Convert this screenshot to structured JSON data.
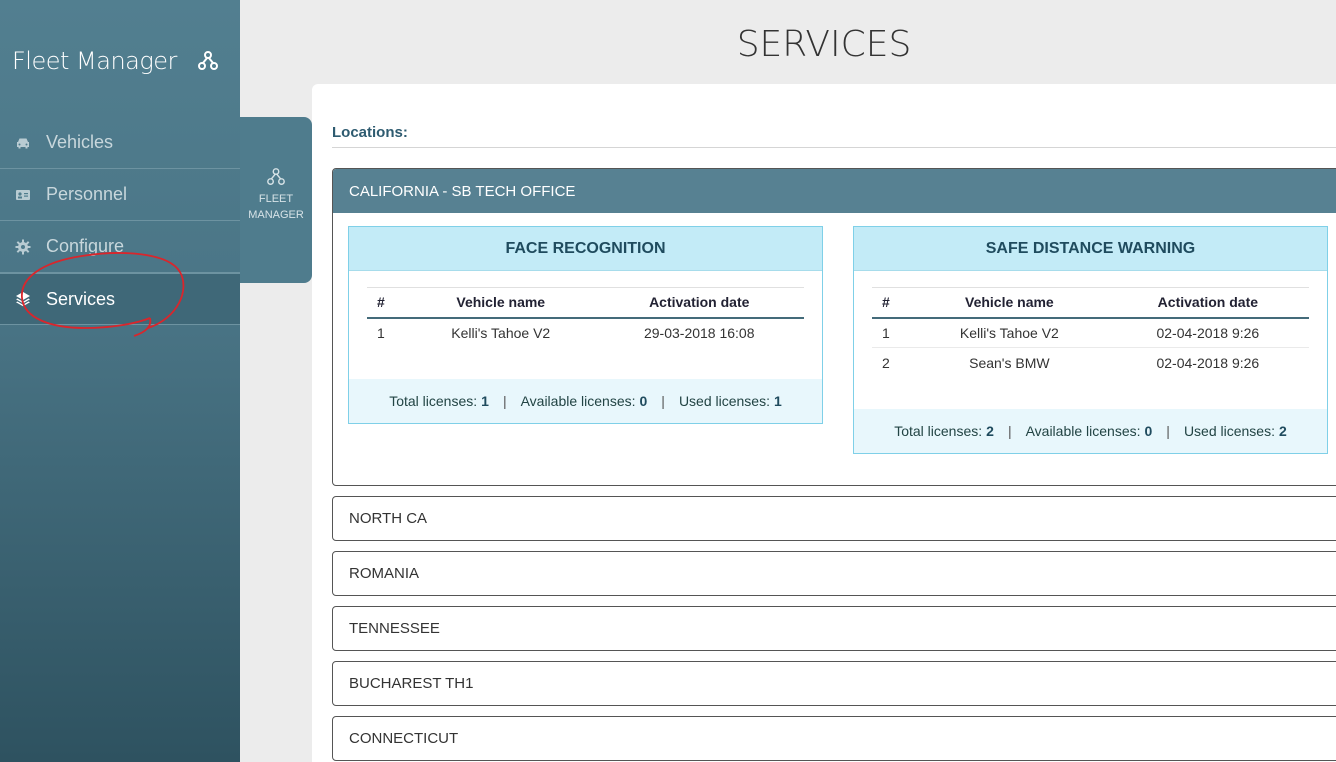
{
  "sidebar": {
    "brand": "Fleet Manager",
    "brand_icon": "nodes-icon",
    "items": [
      {
        "label": "Vehicles",
        "icon": "car-icon"
      },
      {
        "label": "Personnel",
        "icon": "id-card-icon"
      },
      {
        "label": "Configure",
        "icon": "gear-icon"
      },
      {
        "label": "Services",
        "icon": "layers-icon",
        "active": true
      }
    ]
  },
  "subtab": {
    "label": "FLEET\nMANAGER",
    "icon": "nodes-icon"
  },
  "header": {
    "title": "SERVICES"
  },
  "main": {
    "locations_label": "Locations:",
    "open_location": {
      "name": "CALIFORNIA - SB TECH OFFICE",
      "services": [
        {
          "title": "FACE RECOGNITION",
          "columns": [
            "#",
            "Vehicle name",
            "Activation date"
          ],
          "rows": [
            [
              "1",
              "Kelli's Tahoe V2",
              "29-03-2018 16:08"
            ]
          ],
          "total_label": "Total licenses:",
          "total": "1",
          "available_label": "Available licenses:",
          "available": "0",
          "used_label": "Used licenses:",
          "used": "1"
        },
        {
          "title": "SAFE DISTANCE WARNING",
          "columns": [
            "#",
            "Vehicle name",
            "Activation date"
          ],
          "rows": [
            [
              "1",
              "Kelli's Tahoe V2",
              "02-04-2018 9:26"
            ],
            [
              "2",
              "Sean's BMW",
              "02-04-2018 9:26"
            ]
          ],
          "total_label": "Total licenses:",
          "total": "2",
          "available_label": "Available licenses:",
          "available": "0",
          "used_label": "Used licenses:",
          "used": "2"
        }
      ]
    },
    "other_locations": [
      "NORTH CA",
      "ROMANIA",
      "TENNESSEE",
      "BUCHAREST TH1",
      "CONNECTICUT"
    ],
    "separator": "|"
  },
  "colors": {
    "sidebar": "#4a7586",
    "accent": "#578192",
    "service_header": "#c3ebf7",
    "annotation": "#d9262c"
  }
}
